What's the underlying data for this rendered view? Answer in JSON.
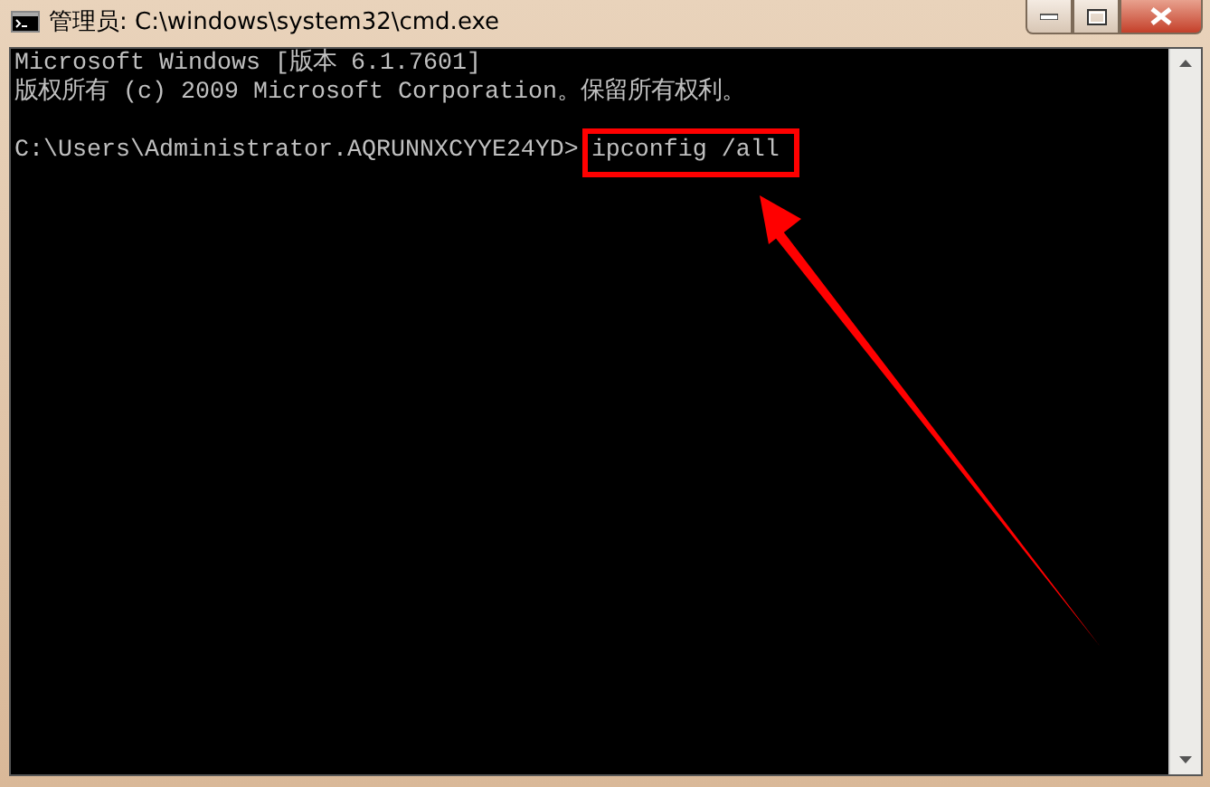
{
  "window": {
    "title": "管理员: C:\\windows\\system32\\cmd.exe"
  },
  "console": {
    "lines": [
      "Microsoft Windows [版本 6.1.7601]",
      "版权所有 (c) 2009 Microsoft Corporation。保留所有权利。"
    ],
    "prompt": "C:\\Users\\Administrator.AQRUNNXCYYE24YD>",
    "command": "ipconfig /all"
  }
}
